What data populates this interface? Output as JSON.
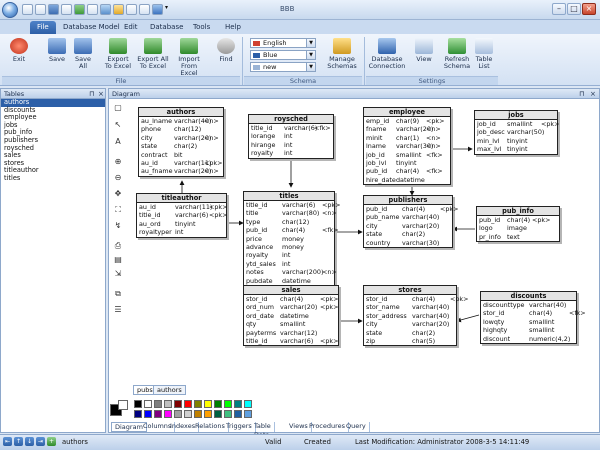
{
  "window": {
    "title": "BBB"
  },
  "menu": [
    "File",
    "Database Model",
    "Edit",
    "Database",
    "Tools",
    "Help"
  ],
  "ribbon": {
    "file_group": {
      "label": "File",
      "buttons": [
        "Exit",
        "Save",
        "Save\nAll",
        "Export\nTo Excel",
        "Export All\nTo Excel",
        "Import\nFrom Excel",
        "Find"
      ]
    },
    "schema_group": {
      "label": "Schema",
      "language": "English",
      "color": "Blue",
      "mode": "new",
      "button": "Manage\nSchemas"
    },
    "settings_group": {
      "label": "Settings",
      "buttons": [
        "Database\nConnection",
        "View",
        "Refresh\nSchema",
        "Table\nList"
      ]
    }
  },
  "tables_panel": {
    "title": "Tables",
    "items": [
      "authors",
      "discounts",
      "employee",
      "jobs",
      "pub_info",
      "publishers",
      "roysched",
      "sales",
      "stores",
      "titleauthor",
      "titles"
    ],
    "selected": "authors"
  },
  "diagram_panel": {
    "title": "Diagram"
  },
  "entities": [
    {
      "name": "authors",
      "rows": [
        [
          "au_lname",
          "varchar(40)",
          "<n>"
        ],
        [
          "phone",
          "char(12)",
          ""
        ],
        [
          "city",
          "varchar(20)",
          "<n>"
        ],
        [
          "state",
          "char(2)",
          ""
        ],
        [
          "contract",
          "bit",
          ""
        ],
        [
          "au_id",
          "varchar(11)",
          "<pk>"
        ],
        [
          "au_fname",
          "varchar(20)",
          "<n>"
        ]
      ]
    },
    {
      "name": "roysched",
      "rows": [
        [
          "title_id",
          "varchar(6)",
          "<fk>"
        ],
        [
          "lorange",
          "int",
          ""
        ],
        [
          "hirange",
          "int",
          ""
        ],
        [
          "royalty",
          "int",
          ""
        ]
      ]
    },
    {
      "name": "employee",
      "rows": [
        [
          "emp_id",
          "char(9)",
          "<pk>"
        ],
        [
          "fname",
          "varchar(20)",
          "<n>"
        ],
        [
          "minit",
          "char(1)",
          "<n>"
        ],
        [
          "lname",
          "varchar(30)",
          "<n>"
        ],
        [
          "job_id",
          "smallint",
          "<fk>"
        ],
        [
          "job_lvl",
          "tinyint",
          ""
        ],
        [
          "pub_id",
          "char(4)",
          "<fk>"
        ],
        [
          "hire_date",
          "datetime",
          ""
        ]
      ]
    },
    {
      "name": "jobs",
      "rows": [
        [
          "job_id",
          "smallint",
          "<pk>"
        ],
        [
          "job_desc",
          "varchar(50)",
          ""
        ],
        [
          "min_lvl",
          "tinyint",
          ""
        ],
        [
          "max_lvl",
          "tinyint",
          ""
        ]
      ]
    },
    {
      "name": "titleauthor",
      "rows": [
        [
          "au_id",
          "varchar(11)",
          "<pk>"
        ],
        [
          "title_id",
          "varchar(6)",
          "<pk>"
        ],
        [
          "au_ord",
          "tinyint",
          ""
        ],
        [
          "royaltyper",
          "int",
          ""
        ]
      ]
    },
    {
      "name": "titles",
      "rows": [
        [
          "title_id",
          "varchar(6)",
          "<pk>"
        ],
        [
          "title",
          "varchar(80)",
          "<n>"
        ],
        [
          "type",
          "char(12)",
          ""
        ],
        [
          "pub_id",
          "char(4)",
          "<fk>"
        ],
        [
          "price",
          "money",
          ""
        ],
        [
          "advance",
          "money",
          ""
        ],
        [
          "royalty",
          "int",
          ""
        ],
        [
          "ytd_sales",
          "int",
          ""
        ],
        [
          "notes",
          "varchar(200)",
          "<n>"
        ],
        [
          "pubdate",
          "datetime",
          ""
        ]
      ]
    },
    {
      "name": "publishers",
      "rows": [
        [
          "pub_id",
          "char(4)",
          "<pk>"
        ],
        [
          "pub_name",
          "varchar(40)",
          ""
        ],
        [
          "city",
          "varchar(20)",
          ""
        ],
        [
          "state",
          "char(2)",
          ""
        ],
        [
          "country",
          "varchar(30)",
          ""
        ]
      ]
    },
    {
      "name": "pub_info",
      "rows": [
        [
          "pub_id",
          "char(4)",
          "<pk>"
        ],
        [
          "logo",
          "image",
          ""
        ],
        [
          "pr_info",
          "text",
          ""
        ]
      ]
    },
    {
      "name": "sales",
      "rows": [
        [
          "stor_id",
          "char(4)",
          "<pk>"
        ],
        [
          "ord_num",
          "varchar(20)",
          "<pk>"
        ],
        [
          "ord_date",
          "datetime",
          ""
        ],
        [
          "qty",
          "smallint",
          ""
        ],
        [
          "payterms",
          "varchar(12)",
          ""
        ],
        [
          "title_id",
          "varchar(6)",
          "<pk>"
        ]
      ]
    },
    {
      "name": "stores",
      "rows": [
        [
          "stor_id",
          "char(4)",
          "<pk>"
        ],
        [
          "stor_name",
          "varchar(40)",
          ""
        ],
        [
          "stor_address",
          "varchar(40)",
          ""
        ],
        [
          "city",
          "varchar(20)",
          ""
        ],
        [
          "state",
          "char(2)",
          ""
        ],
        [
          "zip",
          "char(5)",
          ""
        ]
      ]
    },
    {
      "name": "discounts",
      "rows": [
        [
          "discounttype",
          "varchar(40)",
          ""
        ],
        [
          "stor_id",
          "char(4)",
          "<fk>"
        ],
        [
          "lowqty",
          "smallint",
          ""
        ],
        [
          "highqty",
          "smallint",
          ""
        ],
        [
          "discount",
          "numeric(4,2)",
          ""
        ]
      ]
    }
  ],
  "diagram_tabs": [
    "pubs",
    "authors"
  ],
  "bottom_tabs": [
    "Diagram",
    "Columns",
    "Indexes",
    "Relations",
    "Triggers",
    "Table Data",
    "Views",
    "Procedures",
    "Query"
  ],
  "status": {
    "current": "authors",
    "valid": "Valid",
    "created": "Created",
    "modified": "Last Modification: Administrator 2008-3-5 14:11:49"
  },
  "palette": [
    "#000000",
    "#ffffff",
    "#808080",
    "#c0c0c0",
    "#800000",
    "#ff0000",
    "#808000",
    "#ffff00",
    "#008000",
    "#00ff00",
    "#008080",
    "#00ffff",
    "#000080",
    "#0000ff",
    "#800080",
    "#ff00ff",
    "#a0a0a0",
    "#d0d0d0",
    "#c08000",
    "#ffa000",
    "#006040",
    "#40c080",
    "#2060a0",
    "#60a0e0"
  ]
}
